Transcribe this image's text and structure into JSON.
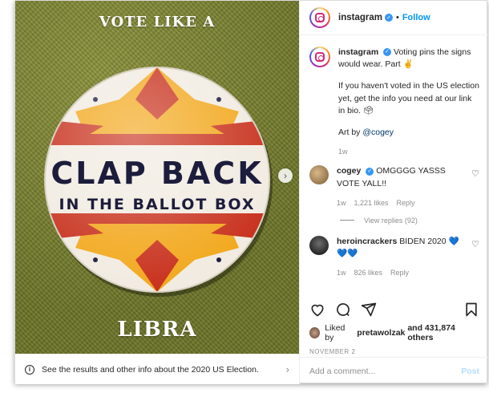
{
  "image": {
    "top_text": "VOTE LIKE A",
    "bottom_text": "LIBRA",
    "pin_line1": "CLAP BACK",
    "pin_line2": "IN THE BALLOT BOX"
  },
  "election_bar": {
    "text": "See the results and other info about the 2020 US Election."
  },
  "header": {
    "username": "instagram",
    "separator": "•",
    "follow": "Follow"
  },
  "caption": {
    "username": "instagram",
    "line1": "Voting pins the signs would wear. Part ✌",
    "line2": "If you haven't voted in the US election yet, get the info you need at our link in bio. 🗳",
    "art_prefix": "Art by ",
    "art_mention": "@cogey",
    "time": "1w"
  },
  "comments": [
    {
      "username": "cogey",
      "text": "OMGGGG YASSS VOTE YALL!!",
      "time": "1w",
      "likes": "1,221 likes",
      "reply": "Reply",
      "view_replies": "View replies (92)"
    },
    {
      "username": "heroincrackers",
      "text": "BIDEN 2020 💙💙💙",
      "time": "1w",
      "likes": "826 likes",
      "reply": "Reply"
    }
  ],
  "likes": {
    "prefix": "Liked by ",
    "user": "pretawolzak",
    "suffix": " and 431,874 others"
  },
  "date": "NOVEMBER 2",
  "add_comment": {
    "placeholder": "Add a comment...",
    "post": "Post"
  },
  "colors": {
    "accent": "#0095f6",
    "pin_red": "#c8321e",
    "pin_yellow": "#f2a81d",
    "background_fabric": "#7d8532"
  }
}
